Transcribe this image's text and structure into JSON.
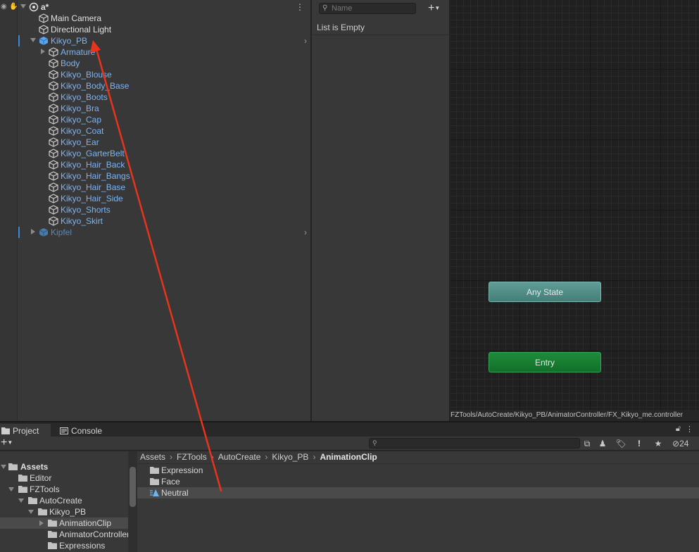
{
  "hierarchy": {
    "scene_name": "a*",
    "items": [
      {
        "label": "Main Camera"
      },
      {
        "label": "Directional Light"
      },
      {
        "label": "Kikyo_PB"
      },
      {
        "label": "Armature"
      },
      {
        "label": "Body"
      },
      {
        "label": "Kikyo_Blouse"
      },
      {
        "label": "Kikyo_Body_Base"
      },
      {
        "label": "Kikyo_Boots"
      },
      {
        "label": "Kikyo_Bra"
      },
      {
        "label": "Kikyo_Cap"
      },
      {
        "label": "Kikyo_Coat"
      },
      {
        "label": "Kikyo_Ear"
      },
      {
        "label": "Kikyo_GarterBelt"
      },
      {
        "label": "Kikyo_Hair_Back"
      },
      {
        "label": "Kikyo_Hair_Bangs"
      },
      {
        "label": "Kikyo_Hair_Base"
      },
      {
        "label": "Kikyo_Hair_Side"
      },
      {
        "label": "Kikyo_Shorts"
      },
      {
        "label": "Kikyo_Skirt"
      },
      {
        "label": "Kipfel"
      }
    ]
  },
  "parameters": {
    "search_placeholder": "Name",
    "add_label": "+",
    "empty_text": "List is Empty"
  },
  "animator": {
    "states": {
      "any_state": "Any State",
      "entry": "Entry"
    },
    "path": "FZTools/AutoCreate/Kikyo_PB/AnimatorController/FX_Kikyo_me.controller"
  },
  "project": {
    "tabs": {
      "project": "Project",
      "console": "Console"
    },
    "add_label": "+",
    "hidden_count": "24",
    "tree": [
      {
        "label": "Assets"
      },
      {
        "label": "Editor"
      },
      {
        "label": "FZTools"
      },
      {
        "label": "AutoCreate"
      },
      {
        "label": "Kikyo_PB"
      },
      {
        "label": "AnimationClip"
      },
      {
        "label": "AnimatorController"
      },
      {
        "label": "Expressions"
      }
    ],
    "breadcrumb": [
      "Assets",
      "FZTools",
      "AutoCreate",
      "Kikyo_PB",
      "AnimationClip"
    ],
    "items": [
      {
        "label": "Expression"
      },
      {
        "label": "Face"
      },
      {
        "label": "Neutral"
      }
    ]
  },
  "colors": {
    "annotation_arrow": "#e8341c",
    "selected_blue": "#7cb4f4",
    "any_state": "#4f8e87",
    "entry_state": "#157a31"
  }
}
